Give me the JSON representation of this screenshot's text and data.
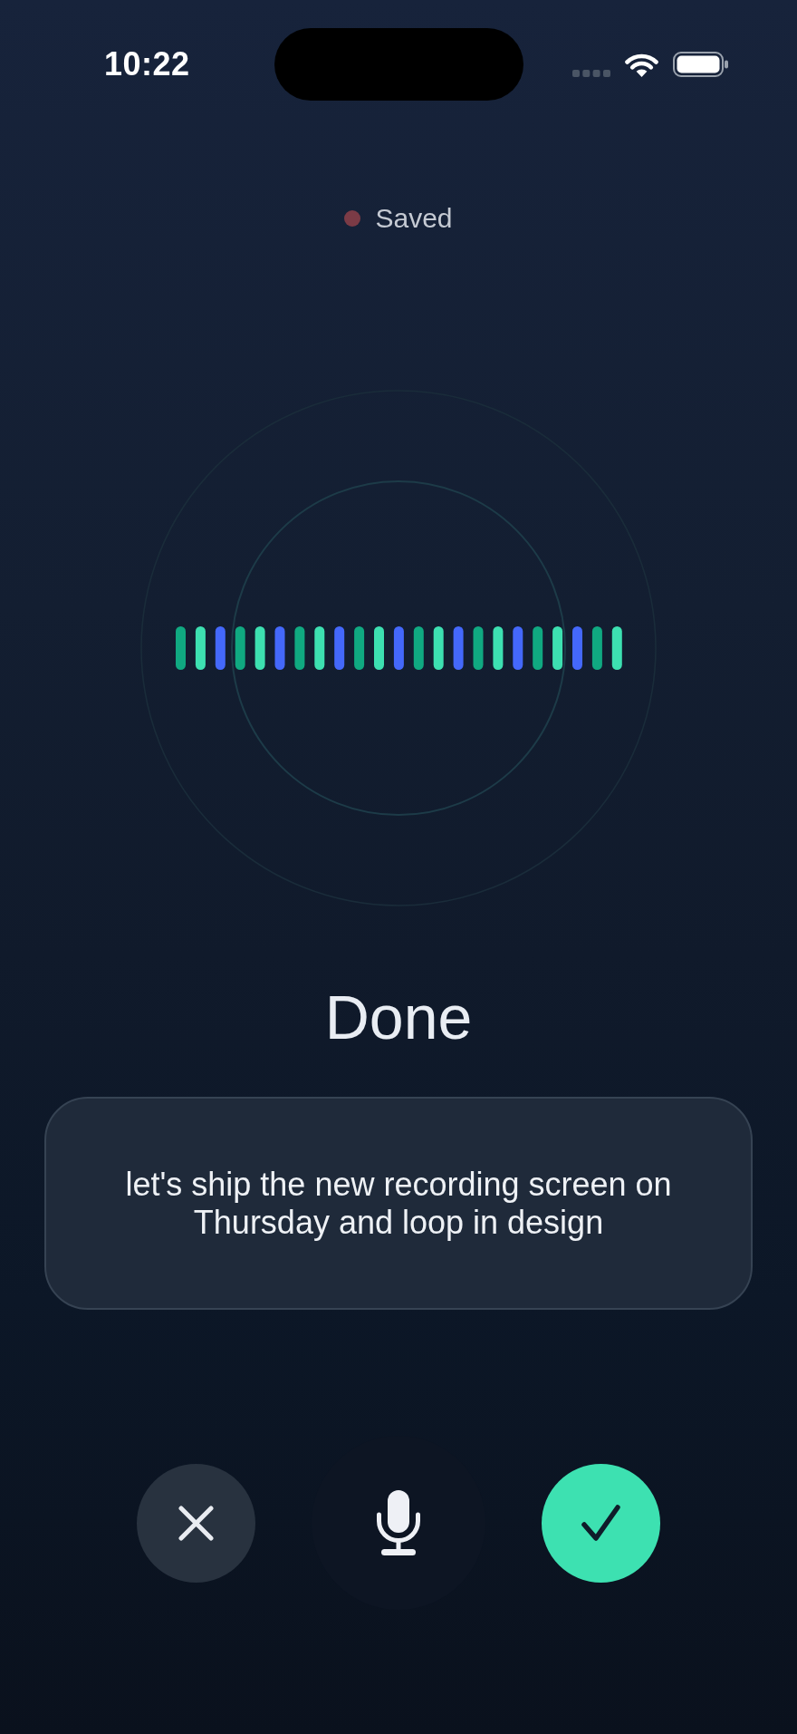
{
  "status_bar": {
    "time": "10:22"
  },
  "save_status": {
    "label": "Saved"
  },
  "title": "Done",
  "transcript": {
    "text": "let's ship the new recording screen on Thursday and loop in design"
  }
}
